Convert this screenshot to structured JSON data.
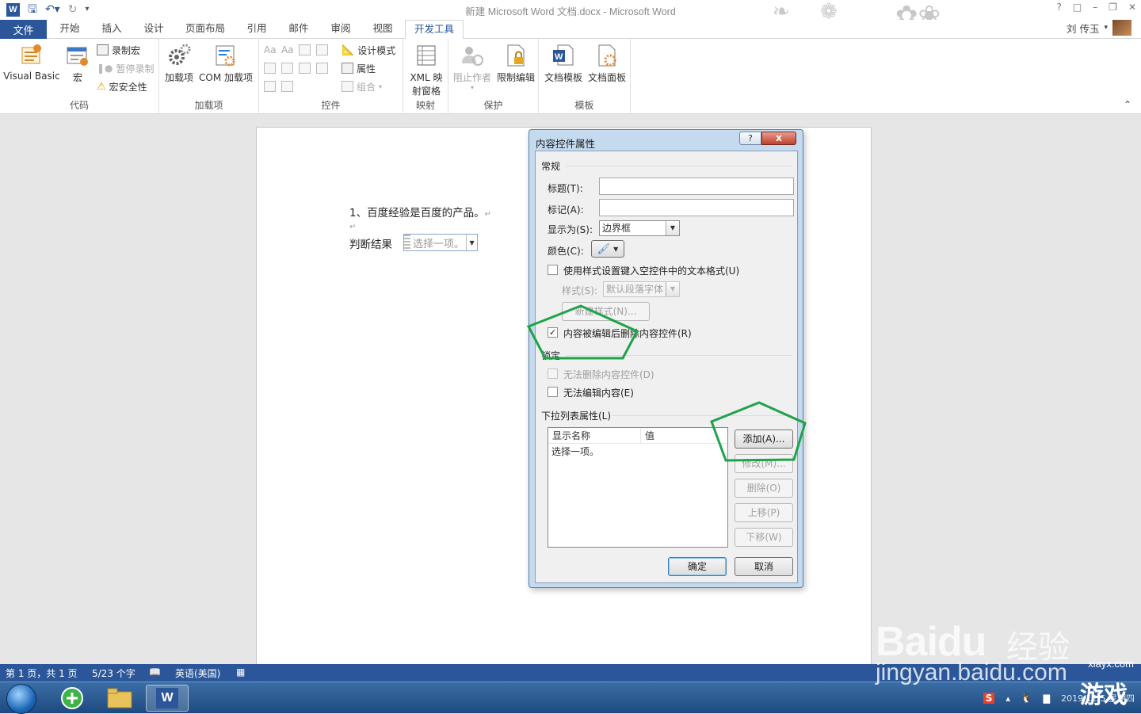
{
  "window": {
    "title": "新建 Microsoft Word 文档.docx - Microsoft Word",
    "qat": {
      "app_icon": "W",
      "save_icon": "save-icon",
      "undo_icon": "undo-icon",
      "redo_icon": "redo-icon"
    }
  },
  "tabs": {
    "file": "文件",
    "items": [
      "开始",
      "插入",
      "设计",
      "页面布局",
      "引用",
      "邮件",
      "审阅",
      "视图",
      "开发工具"
    ],
    "active": "开发工具",
    "user": "刘 传玉"
  },
  "ribbon": {
    "code": {
      "label": "代码",
      "visual_basic": "Visual Basic",
      "macro": "宏",
      "record_macro": "录制宏",
      "pause_record": "暂停录制",
      "macro_security": "宏安全性"
    },
    "addins": {
      "label": "加载项",
      "addin": "加载项",
      "com_addin": "COM 加载项"
    },
    "controls": {
      "label": "控件",
      "design_mode": "设计模式",
      "properties": "属性",
      "group": "组合",
      "aa1": "Aa",
      "aa2": "Aa"
    },
    "mapping": {
      "label": "映射",
      "xml_line1": "XML 映",
      "xml_line2": "射窗格"
    },
    "protect": {
      "label": "保护",
      "block_authors": "阻止作者",
      "restrict_editing": "限制编辑"
    },
    "templates": {
      "label": "模板",
      "doc_template": "文档模板",
      "doc_panel": "文档面板"
    }
  },
  "document": {
    "line1": "1、百度经验是百度的产品。",
    "para_mark": "↵",
    "result_label": "判断结果",
    "dropdown_placeholder": "选择一项。"
  },
  "dialog": {
    "title": "内容控件属性",
    "help": "?",
    "close": "x",
    "general": "常规",
    "title_label": "标题(T):",
    "tag_label": "标记(A):",
    "show_as_label": "显示为(S):",
    "show_as_value": "边界框",
    "color_label": "颜色(C):",
    "use_style_label": "使用样式设置键入空控件中的文本格式(U)",
    "style_label": "样式(S):",
    "style_value": "默认段落字体",
    "new_style_btn": "新建样式(N)...",
    "remove_when_edited": "内容被编辑后删除内容控件(R)",
    "remove_when_edited_checked": true,
    "locking": "锁定",
    "cannot_delete": "无法删除内容控件(D)",
    "cannot_edit": "无法编辑内容(E)",
    "dropdown_props": "下拉列表属性(L)",
    "list_headers": [
      "显示名称",
      "值"
    ],
    "list_items": [
      {
        "display": "选择一项。",
        "value": ""
      }
    ],
    "add_btn": "添加(A)...",
    "modify_btn": "修改(M)...",
    "delete_btn": "删除(O)",
    "up_btn": "上移(P)",
    "down_btn": "下移(W)",
    "ok_btn": "确定",
    "cancel_btn": "取消"
  },
  "status": {
    "page": "第 1 页，共 1 页",
    "words": "5/23 个字",
    "language": "英语(美国)"
  },
  "taskbar": {
    "clock_date": "2019/12/5 星期四",
    "ime": "S"
  },
  "watermark": {
    "baidu": "Baidu",
    "jingyan": "经验",
    "url": "jingyan.baidu.com",
    "site": "xiayx.com",
    "game": "游戏"
  },
  "colors": {
    "word_blue": "#2b579a",
    "annotation_green": "#1fa34a"
  }
}
